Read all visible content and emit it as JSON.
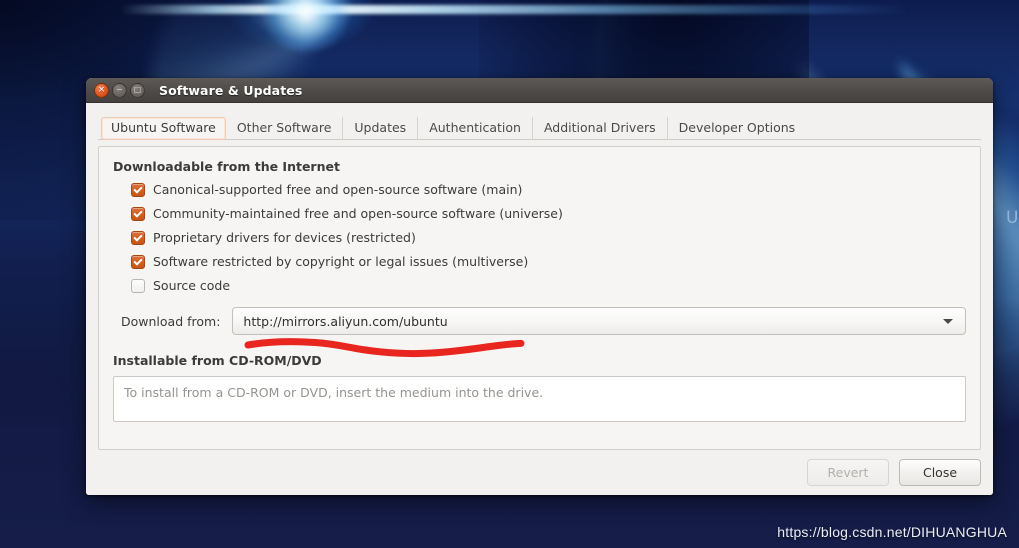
{
  "window": {
    "title": "Software & Updates",
    "controls": {
      "close": "×",
      "minimize": "−",
      "maximize": "□"
    }
  },
  "tabs": [
    {
      "label": "Ubuntu Software",
      "active": true
    },
    {
      "label": "Other Software",
      "active": false
    },
    {
      "label": "Updates",
      "active": false
    },
    {
      "label": "Authentication",
      "active": false
    },
    {
      "label": "Additional Drivers",
      "active": false
    },
    {
      "label": "Developer Options",
      "active": false
    }
  ],
  "sections": {
    "internet": {
      "title": "Downloadable from the Internet",
      "checkboxes": [
        {
          "label": "Canonical-supported free and open-source software (main)",
          "checked": true
        },
        {
          "label": "Community-maintained free and open-source software (universe)",
          "checked": true
        },
        {
          "label": "Proprietary drivers for devices (restricted)",
          "checked": true
        },
        {
          "label": "Software restricted by copyright or legal issues (multiverse)",
          "checked": true
        },
        {
          "label": "Source code",
          "checked": false
        }
      ],
      "download_from": {
        "label": "Download from:",
        "value": "http://mirrors.aliyun.com/ubuntu"
      }
    },
    "cdrom": {
      "title": "Installable from CD-ROM/DVD",
      "empty_text": "To install from a CD-ROM or DVD, insert the medium into the drive."
    }
  },
  "footer": {
    "revert_label": "Revert",
    "revert_enabled": false,
    "close_label": "Close",
    "close_enabled": true
  },
  "annotation": {
    "color": "#e8261f",
    "kind": "hand-drawn-underline"
  },
  "watermark": {
    "text": "https://blog.csdn.net/DIHUANGHUA"
  },
  "desktop": {
    "edge_glyph": "U",
    "wallpaper_accent": "#1f5fd0",
    "wallpaper_base": "#101a42"
  },
  "colors": {
    "checkbox_checked": "#d2601f",
    "active_tab_outline": "#f0c9b2",
    "titlebar": "#4f4c49"
  }
}
